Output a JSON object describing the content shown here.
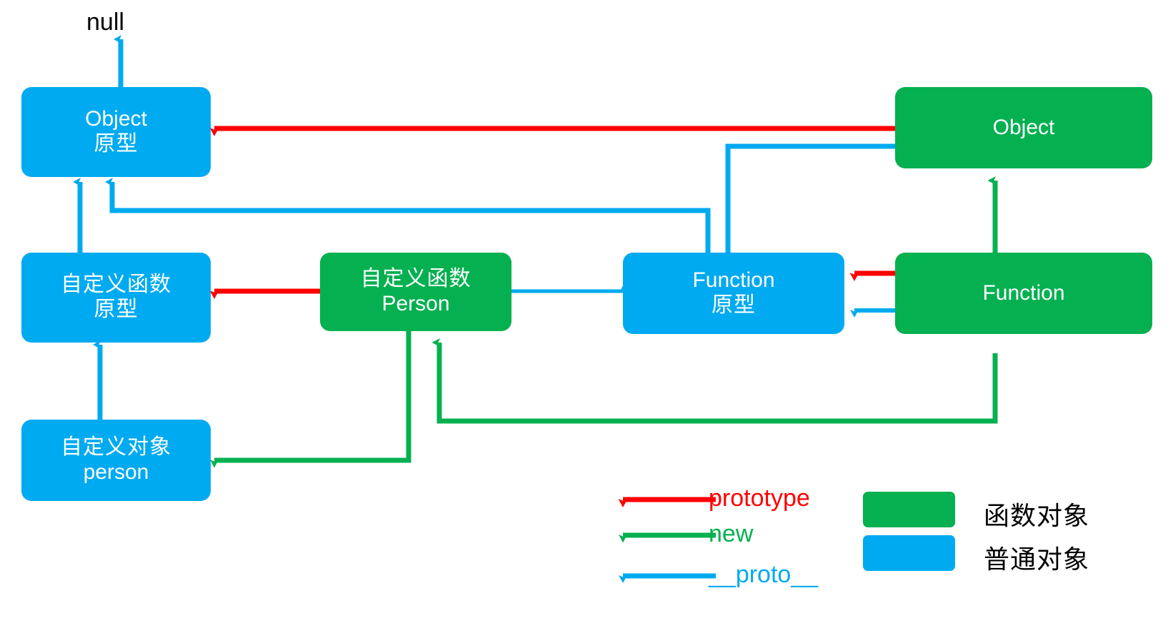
{
  "diagram": {
    "title_text": "null",
    "colors": {
      "plain_object": "#00AAF0",
      "function_object": "#05B050",
      "prototype_arrow": "#FF0000",
      "new_arrow": "#05B050",
      "proto_arrow": "#00AAF0",
      "text_on_node": "#FFFFFF",
      "label_text": "#000000"
    },
    "nodes": [
      {
        "id": "object-prototype",
        "kind": "plain_object",
        "line1": "Object",
        "line2": "原型"
      },
      {
        "id": "custom-function-prototype",
        "kind": "plain_object",
        "line1": "自定义函数",
        "line2": "原型"
      },
      {
        "id": "custom-object-person",
        "kind": "plain_object",
        "line1": "自定义对象",
        "line2": "person"
      },
      {
        "id": "function-prototype",
        "kind": "plain_object",
        "line1": "Function",
        "line2": "原型"
      },
      {
        "id": "custom-function-person",
        "kind": "function_object",
        "line1": "自定义函数",
        "line2": "Person"
      },
      {
        "id": "object-constructor",
        "kind": "function_object",
        "line1": "Object",
        "line2": ""
      },
      {
        "id": "function-constructor",
        "kind": "function_object",
        "line1": "Function",
        "line2": ""
      }
    ]
  },
  "legend": {
    "arrows": [
      {
        "id": "prototype",
        "label": "prototype",
        "color": "#FF0000"
      },
      {
        "id": "new",
        "label": "new",
        "color": "#05B050"
      },
      {
        "id": "proto",
        "label": "__proto__",
        "color": "#00AAF0"
      }
    ],
    "swatches": [
      {
        "id": "function-object",
        "label": "函数对象",
        "color": "#05B050"
      },
      {
        "id": "plain-object",
        "label": "普通对象",
        "color": "#00AAF0"
      }
    ]
  }
}
